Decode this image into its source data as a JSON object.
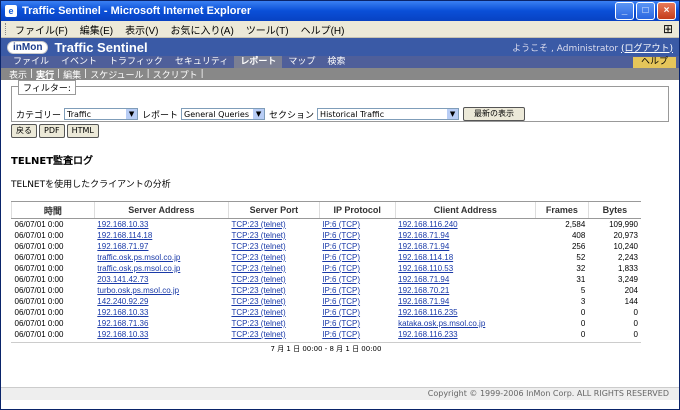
{
  "window": {
    "title": "Traffic Sentinel - Microsoft Internet Explorer"
  },
  "menubar": [
    "ファイル(F)",
    "編集(E)",
    "表示(V)",
    "お気に入り(A)",
    "ツール(T)",
    "ヘルプ(H)"
  ],
  "app": {
    "logo": "inMon",
    "name": "Traffic Sentinel",
    "welcome": "ようこそ , Administrator",
    "logout": "(ログアウト)"
  },
  "nav": {
    "tabs": [
      "ファイル",
      "イベント",
      "トラフィック",
      "セキュリティ",
      "レポート",
      "マップ",
      "検索"
    ],
    "active": 4,
    "help": "ヘルプ"
  },
  "subnav": [
    "表示",
    "実行",
    "編集",
    "スケジュール",
    "スクリプト"
  ],
  "filter": {
    "legend": "フィルター:",
    "category_label": "カテゴリー",
    "category_value": "Traffic",
    "report_label": "レポート",
    "report_value": "General Queries",
    "section_label": "セクション",
    "section_value": "Historical Traffic",
    "refresh": "最新の表示",
    "back": "戻る",
    "pdf": "PDF",
    "html": "HTML"
  },
  "report": {
    "title": "TELNET監査ログ",
    "desc": "TELNETを使用したクライアントの分析"
  },
  "table": {
    "headers": [
      "時間",
      "Server Address",
      "Server Port",
      "IP Protocol",
      "Client Address",
      "Frames",
      "Bytes"
    ],
    "rows": [
      [
        "06/07/01 0:00",
        "192.168.10.33",
        "TCP:23 (telnet)",
        "IP:6 (TCP)",
        "192.168.116.240",
        "2,584",
        "109,990"
      ],
      [
        "06/07/01 0:00",
        "192.168.114.18",
        "TCP:23 (telnet)",
        "IP:6 (TCP)",
        "192.168.71.94",
        "408",
        "20,973"
      ],
      [
        "06/07/01 0:00",
        "192.168.71.97",
        "TCP:23 (telnet)",
        "IP:6 (TCP)",
        "192.168.71.94",
        "256",
        "10,240"
      ],
      [
        "06/07/01 0:00",
        "traffic.osk.ps.msol.co.jp",
        "TCP:23 (telnet)",
        "IP:6 (TCP)",
        "192.168.114.18",
        "52",
        "2,243"
      ],
      [
        "06/07/01 0:00",
        "traffic.osk.ps.msol.co.jp",
        "TCP:23 (telnet)",
        "IP:6 (TCP)",
        "192.168.110.53",
        "32",
        "1,833"
      ],
      [
        "06/07/01 0:00",
        "203.141.42.73",
        "TCP:23 (telnet)",
        "IP:6 (TCP)",
        "192.168.71.94",
        "31",
        "3,249"
      ],
      [
        "06/07/01 0:00",
        "turbo.osk.ps.msol.co.jp",
        "TCP:23 (telnet)",
        "IP:6 (TCP)",
        "192.168.70.21",
        "5",
        "204"
      ],
      [
        "06/07/01 0:00",
        "142.240.92.29",
        "TCP:23 (telnet)",
        "IP:6 (TCP)",
        "192.168.71.94",
        "3",
        "144"
      ],
      [
        "06/07/01 0:00",
        "192.168.10.33",
        "TCP:23 (telnet)",
        "IP:6 (TCP)",
        "192.168.116.235",
        "0",
        "0"
      ],
      [
        "06/07/01 0:00",
        "192.168.71.36",
        "TCP:23 (telnet)",
        "IP:6 (TCP)",
        "kataka.osk.ps.msol.co.jp",
        "0",
        "0"
      ],
      [
        "06/07/01 0:00",
        "192.168.10.33",
        "TCP:23 (telnet)",
        "IP:6 (TCP)",
        "192.168.116.233",
        "0",
        "0"
      ]
    ],
    "daterange": "7 月 1 日 00:00 - 8 月 1 日 00:00"
  },
  "footer": "Copyright © 1999-2006 InMon Corp. ALL RIGHTS RESERVED"
}
